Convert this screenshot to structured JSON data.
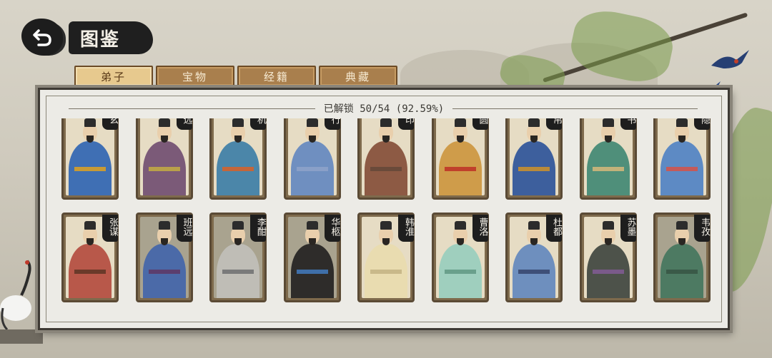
{
  "header": {
    "title": "图鉴"
  },
  "tabs": [
    {
      "label": "弟子",
      "active": true
    },
    {
      "label": "宝物",
      "active": false
    },
    {
      "label": "经籍",
      "active": false
    },
    {
      "label": "典藏",
      "active": false
    }
  ],
  "unlock_status": "已解锁 50/54 (92.59%)",
  "cards_row1": [
    {
      "name": "玄",
      "robe": "#3f6fb4",
      "sash": "#c89a35"
    },
    {
      "name": "远",
      "robe": "#7b5a78",
      "sash": "#b9a04a"
    },
    {
      "name": "机",
      "robe": "#4b86a9",
      "sash": "#c4663a"
    },
    {
      "name": "行",
      "robe": "#6f8fc0",
      "sash": "#8aa0c8"
    },
    {
      "name": "印",
      "robe": "#8d5a44",
      "sash": "#6a4a3a"
    },
    {
      "name": "圆",
      "robe": "#cf9c4a",
      "sash": "#c0402b"
    },
    {
      "name": "帛",
      "robe": "#3d5f9d",
      "sash": "#b98a3a"
    },
    {
      "name": "书",
      "robe": "#4f8f7a",
      "sash": "#c2b27a"
    },
    {
      "name": "隐",
      "robe": "#5d8ac4",
      "sash": "#c45a5a"
    }
  ],
  "cards_row2": [
    {
      "name": "张谋",
      "robe": "#b8584a",
      "sash": "#6a3a2a",
      "dark": false
    },
    {
      "name": "班远",
      "robe": "#4b6aa8",
      "sash": "#5b3e6e",
      "dark": true
    },
    {
      "name": "李酣",
      "robe": "#bfbdb6",
      "sash": "#7a7a7a",
      "dark": true
    },
    {
      "name": "华柩",
      "robe": "#2e2c2a",
      "sash": "#3f6fa8",
      "dark": true
    },
    {
      "name": "韩淮",
      "robe": "#e9dcb0",
      "sash": "#c9b98a",
      "dark": false
    },
    {
      "name": "曹洛",
      "robe": "#9fcfbe",
      "sash": "#6aa08c",
      "dark": false
    },
    {
      "name": "杜都",
      "robe": "#6e8fbe",
      "sash": "#3e4f78",
      "dark": false
    },
    {
      "name": "苏墨",
      "robe": "#4d524a",
      "sash": "#7a5a8a",
      "dark": false
    },
    {
      "name": "韦孜",
      "robe": "#4d7a62",
      "sash": "#3a5a48",
      "dark": true
    }
  ],
  "colors": {
    "panel_bg": "#ecebe6",
    "tab_active": "#e7c98e",
    "tab_inactive": "#a97f4d",
    "ink": "#1e1e1e"
  },
  "icons": {
    "back": "back-arrow-icon"
  }
}
